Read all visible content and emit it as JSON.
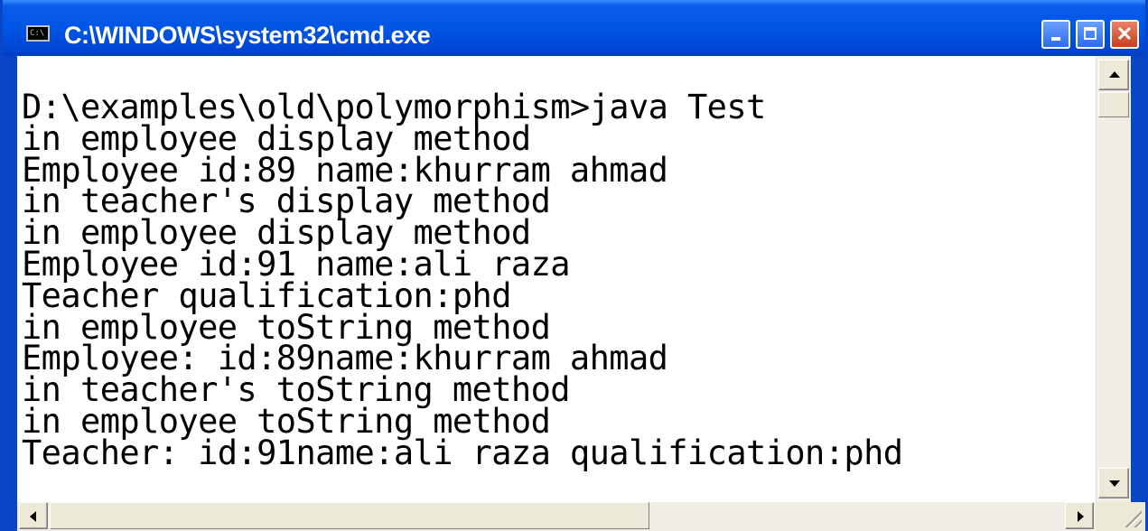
{
  "window": {
    "title": "C:\\WINDOWS\\system32\\cmd.exe",
    "icon": "cmd-console-icon",
    "icon_text": "C:\\",
    "controls": {
      "minimize_icon": "minimize-icon",
      "maximize_icon": "maximize-icon",
      "close_icon": "close-icon",
      "close_glyph": "✕"
    },
    "colors": {
      "titlebar": "#0055e5",
      "console_background": "#ffffff",
      "console_text": "#000000",
      "close_button": "#c8401c"
    }
  },
  "console": {
    "lines": [
      "D:\\examples\\old\\polymorphism>java Test",
      "in employee display method",
      "Employee id:89 name:khurram ahmad",
      "in teacher's display method",
      "in employee display method",
      "Employee id:91 name:ali raza",
      "Teacher qualification:phd",
      "in employee toString method",
      "Employee: id:89name:khurram ahmad",
      "in teacher's toString method",
      "in employee toString method",
      "Teacher: id:91name:ali raza qualification:phd"
    ]
  },
  "scrollbars": {
    "vertical": {
      "up_icon": "scroll-up-icon",
      "down_icon": "scroll-down-icon"
    },
    "horizontal": {
      "left_icon": "scroll-left-icon",
      "right_icon": "scroll-right-icon"
    }
  }
}
